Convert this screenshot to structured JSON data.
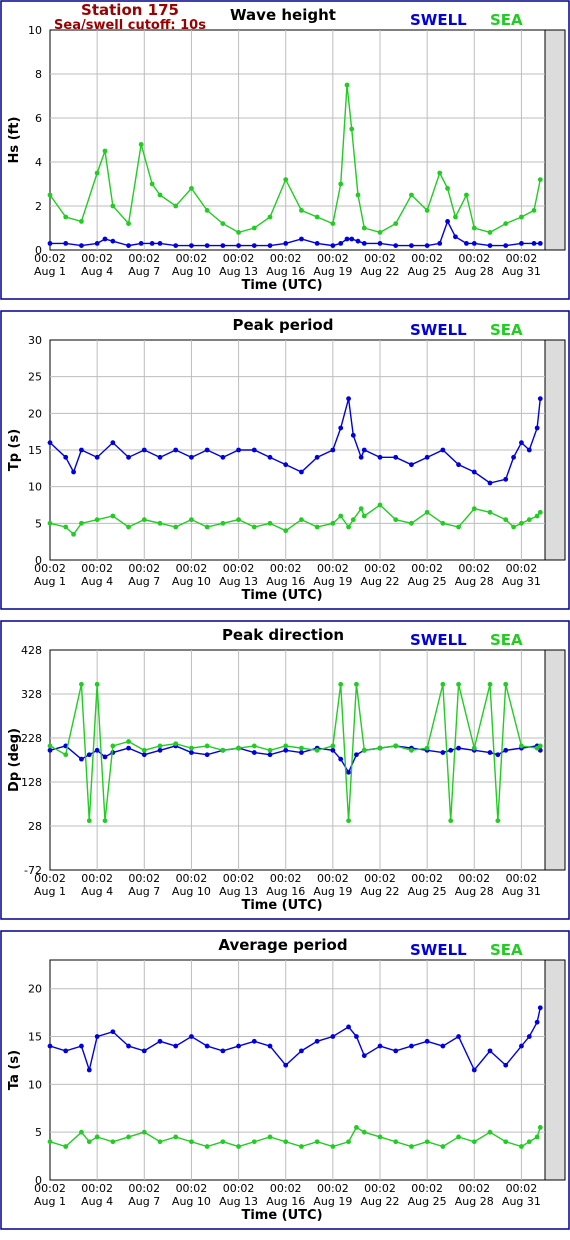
{
  "station": {
    "name": "Station 175",
    "cutoff": "Sea/swell cutoff: 10s"
  },
  "xlabel": "Time (UTC)",
  "x_ticks": {
    "time": "00:02",
    "dates": [
      "Aug 1",
      "Aug 4",
      "Aug 7",
      "Aug 10",
      "Aug 13",
      "Aug 16",
      "Aug 19",
      "Aug 22",
      "Aug 25",
      "Aug 28",
      "Aug 31"
    ]
  },
  "colors": {
    "swell": "#0000dd",
    "sea": "#22cc22",
    "station": "#990000",
    "frame": "#00008b",
    "plot_bg": "#dcdcdc"
  },
  "chart_data": [
    {
      "type": "line",
      "title": "Wave height",
      "ylabel": "Hs (ft)",
      "ylim": [
        0,
        10
      ],
      "yticks": [
        "0",
        "2",
        "4",
        "6",
        "8",
        "10"
      ],
      "legend": [
        "SWELL",
        "SEA"
      ],
      "x_days": [
        0,
        1,
        2,
        3,
        3.5,
        4,
        5,
        5.8,
        6.5,
        7,
        8,
        9,
        10,
        11,
        12,
        13,
        14,
        15,
        16,
        17,
        18,
        18.5,
        18.9,
        19.2,
        19.6,
        20,
        21,
        22,
        23,
        24,
        24.8,
        25.3,
        25.8,
        26.5,
        27,
        28,
        29,
        30,
        30.8,
        31.2
      ],
      "series": [
        {
          "name": "SWELL",
          "values": [
            0.3,
            0.3,
            0.2,
            0.3,
            0.5,
            0.4,
            0.2,
            0.3,
            0.3,
            0.3,
            0.2,
            0.2,
            0.2,
            0.2,
            0.2,
            0.2,
            0.2,
            0.3,
            0.5,
            0.3,
            0.2,
            0.3,
            0.5,
            0.5,
            0.4,
            0.3,
            0.3,
            0.2,
            0.2,
            0.2,
            0.3,
            1.3,
            0.6,
            0.3,
            0.3,
            0.2,
            0.2,
            0.3,
            0.3,
            0.3
          ]
        },
        {
          "name": "SEA",
          "values": [
            2.5,
            1.5,
            1.3,
            3.5,
            4.5,
            2.0,
            1.2,
            4.8,
            3.0,
            2.5,
            2.0,
            2.8,
            1.8,
            1.2,
            0.8,
            1.0,
            1.5,
            3.2,
            1.8,
            1.5,
            1.2,
            3.0,
            7.5,
            5.5,
            2.5,
            1.0,
            0.8,
            1.2,
            2.5,
            1.8,
            3.5,
            2.8,
            1.5,
            2.5,
            1.0,
            0.8,
            1.2,
            1.5,
            1.8,
            3.2
          ]
        }
      ]
    },
    {
      "type": "line",
      "title": "Peak period",
      "ylabel": "Tp (s)",
      "ylim": [
        0,
        30
      ],
      "yticks": [
        "0",
        "5",
        "10",
        "15",
        "20",
        "25",
        "30"
      ],
      "legend": [
        "SWELL",
        "SEA"
      ],
      "x_days": [
        0,
        1,
        1.5,
        2,
        3,
        4,
        5,
        6,
        7,
        8,
        9,
        10,
        11,
        12,
        13,
        14,
        15,
        16,
        17,
        18,
        18.5,
        19,
        19.3,
        19.8,
        20,
        21,
        22,
        23,
        24,
        25,
        26,
        27,
        28,
        29,
        29.5,
        30,
        30.5,
        31,
        31.2
      ],
      "series": [
        {
          "name": "SWELL",
          "values": [
            16,
            14,
            12,
            15,
            14,
            16,
            14,
            15,
            14,
            15,
            14,
            15,
            14,
            15,
            15,
            14,
            13,
            12,
            14,
            15,
            18,
            22,
            17,
            14,
            15,
            14,
            14,
            13,
            14,
            15,
            13,
            12,
            10.5,
            11,
            14,
            16,
            15,
            18,
            22
          ]
        },
        {
          "name": "SEA",
          "values": [
            5,
            4.5,
            3.5,
            5,
            5.5,
            6,
            4.5,
            5.5,
            5,
            4.5,
            5.5,
            4.5,
            5,
            5.5,
            4.5,
            5,
            4,
            5.5,
            4.5,
            5,
            6,
            4.5,
            5.5,
            7,
            6,
            7.5,
            5.5,
            5,
            6.5,
            5,
            4.5,
            7,
            6.5,
            5.5,
            4.5,
            5,
            5.5,
            6,
            6.5
          ]
        }
      ]
    },
    {
      "type": "line",
      "title": "Peak direction",
      "ylabel": "Dp (deg)",
      "ylim": [
        -72,
        428
      ],
      "yticks": [
        "-72",
        "28",
        "128",
        "228",
        "328",
        "428"
      ],
      "legend": [
        "SWELL",
        "SEA"
      ],
      "x_days": [
        0,
        1,
        2,
        2.5,
        3,
        3.5,
        4,
        5,
        6,
        7,
        8,
        9,
        10,
        11,
        12,
        13,
        14,
        15,
        16,
        17,
        18,
        18.5,
        19,
        19.5,
        20,
        21,
        22,
        23,
        24,
        25,
        25.5,
        26,
        27,
        28,
        28.5,
        29,
        30,
        31,
        31.2
      ],
      "series": [
        {
          "name": "SWELL",
          "values": [
            200,
            210,
            180,
            190,
            200,
            185,
            195,
            205,
            190,
            200,
            210,
            195,
            190,
            200,
            205,
            195,
            190,
            200,
            195,
            205,
            200,
            180,
            150,
            190,
            200,
            205,
            210,
            205,
            200,
            195,
            200,
            205,
            200,
            195,
            190,
            200,
            205,
            210,
            200
          ]
        },
        {
          "name": "SEA",
          "values": [
            210,
            190,
            350,
            40,
            350,
            40,
            210,
            220,
            200,
            210,
            215,
            205,
            210,
            200,
            205,
            210,
            200,
            210,
            205,
            200,
            210,
            350,
            40,
            350,
            200,
            205,
            210,
            200,
            205,
            350,
            40,
            350,
            205,
            350,
            40,
            350,
            210,
            205,
            210
          ]
        }
      ]
    },
    {
      "type": "line",
      "title": "Average period",
      "ylabel": "Ta (s)",
      "ylim": [
        0,
        23
      ],
      "yticks": [
        "0",
        "5",
        "10",
        "15",
        "20"
      ],
      "legend": [
        "SWELL",
        "SEA"
      ],
      "x_days": [
        0,
        1,
        2,
        2.5,
        3,
        4,
        5,
        6,
        7,
        8,
        9,
        10,
        11,
        12,
        13,
        14,
        15,
        16,
        17,
        18,
        19,
        19.5,
        20,
        21,
        22,
        23,
        24,
        25,
        26,
        27,
        28,
        29,
        30,
        30.5,
        31,
        31.2
      ],
      "series": [
        {
          "name": "SWELL",
          "values": [
            14,
            13.5,
            14,
            11.5,
            15,
            15.5,
            14,
            13.5,
            14.5,
            14,
            15,
            14,
            13.5,
            14,
            14.5,
            14,
            12,
            13.5,
            14.5,
            15,
            16,
            15,
            13,
            14,
            13.5,
            14,
            14.5,
            14,
            15,
            11.5,
            13.5,
            12,
            14,
            15,
            16.5,
            18
          ]
        },
        {
          "name": "SEA",
          "values": [
            4,
            3.5,
            5,
            4,
            4.5,
            4,
            4.5,
            5,
            4,
            4.5,
            4,
            3.5,
            4,
            3.5,
            4,
            4.5,
            4,
            3.5,
            4,
            3.5,
            4,
            5.5,
            5,
            4.5,
            4,
            3.5,
            4,
            3.5,
            4.5,
            4,
            5,
            4,
            3.5,
            4,
            4.5,
            5.5
          ]
        }
      ]
    }
  ]
}
